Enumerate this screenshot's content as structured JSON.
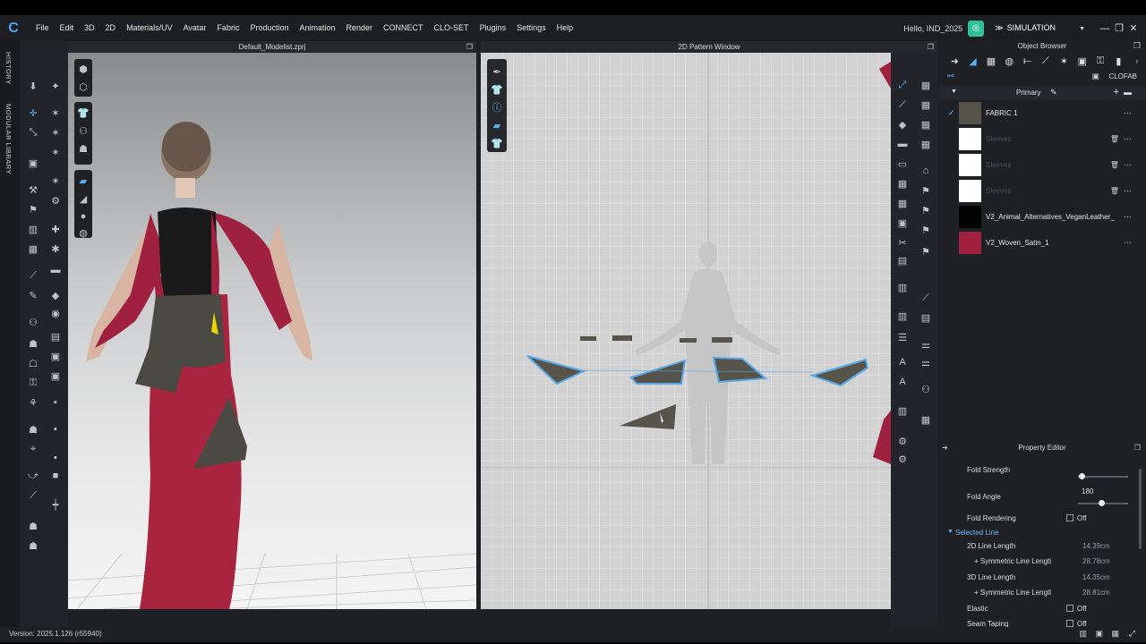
{
  "menu": {
    "items": [
      "File",
      "Edit",
      "3D",
      "2D",
      "Materials/UV",
      "Avatar",
      "Fabric",
      "Production",
      "Animation",
      "Render",
      "CONNECT",
      "CLO-SET",
      "Plugins",
      "Settings",
      "Help"
    ],
    "user": "Hello, IND_2025",
    "mode": "SIMULATION"
  },
  "sidebar": {
    "history": "HISTORY",
    "modular": "MODULAR LIBRARY"
  },
  "view3d": {
    "title": "Default_Modelist.zprj"
  },
  "view2d": {
    "title": "2D Pattern Window"
  },
  "object_browser": {
    "title": "Object Browser",
    "tab_label": "CLOFAB",
    "primary_label": "Primary",
    "fabrics": [
      {
        "name": "FABRIC 1",
        "color": "#56534a",
        "checked": true,
        "dim": false
      },
      {
        "name": "Sleeves",
        "color": "#ffffff",
        "checked": false,
        "dim": true
      },
      {
        "name": "Sleeves",
        "color": "#ffffff",
        "checked": false,
        "dim": true
      },
      {
        "name": "Sleeves",
        "color": "#ffffff",
        "checked": false,
        "dim": true
      },
      {
        "name": "V2_Animal_Alternatives_VeganLeather_",
        "color": "#030303",
        "checked": false,
        "dim": false
      },
      {
        "name": "V2_Woven_Satin_1",
        "color": "#a0213f",
        "checked": false,
        "dim": false
      }
    ]
  },
  "property_editor": {
    "title": "Property Editor",
    "fold_strength": "Fold Strength",
    "fold_angle": "Fold Angle",
    "fold_angle_value": "180",
    "fold_rendering": "Fold Rendering",
    "off": "Off",
    "selected_line": "Selected Line",
    "line2d": "2D Line Length",
    "line2d_value": "14.39cm",
    "sym2d": "+ Symmetric Line Lengtl",
    "sym2d_value": "28.78cm",
    "line3d": "3D Line Length",
    "line3d_value": "14.35cm",
    "sym3d": "+ Symmetric Line Lengtl",
    "sym3d_value": "28.81cm",
    "elastic": "Elastic",
    "seam_taping": "Seam Taping"
  },
  "status": {
    "version": "Version: 2025.1.126 (r55940)"
  },
  "colors": {
    "accent": "#4fb2ff",
    "pattern_fill": "#57544c",
    "pattern_outline": "#5aa9e6",
    "satin": "#a0213f"
  }
}
